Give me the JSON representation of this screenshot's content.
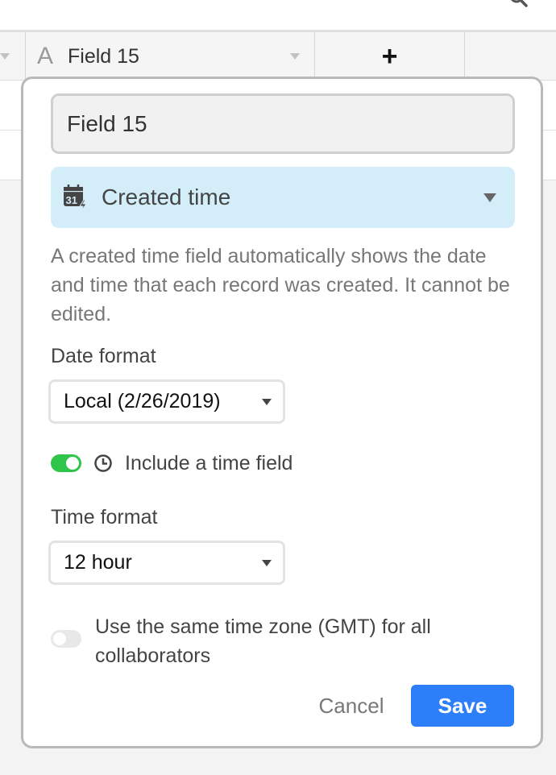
{
  "grid": {
    "header": {
      "field_name": "Field 15",
      "field_type_icon": "text-A-icon",
      "add_field_label": "+"
    },
    "toolbar": {
      "search_icon": "search-icon"
    }
  },
  "field_editor": {
    "name_value": "Field 15",
    "type": {
      "icon": "calendar-created-time-icon",
      "label": "Created time"
    },
    "description": "A created time field automatically shows the date and time that each record was created. It cannot be edited.",
    "date_format": {
      "label": "Date format",
      "selected": "Local (2/26/2019)"
    },
    "include_time": {
      "label": "Include a time field",
      "enabled": true
    },
    "time_format": {
      "label": "Time format",
      "selected": "12 hour"
    },
    "same_timezone": {
      "label": "Use the same time zone (GMT) for all collaborators",
      "enabled": false
    },
    "cancel_label": "Cancel",
    "save_label": "Save"
  },
  "colors": {
    "accent": "#2d7ff9",
    "toggle_on": "#2ec54a",
    "type_select_bg": "#d3eef9"
  }
}
